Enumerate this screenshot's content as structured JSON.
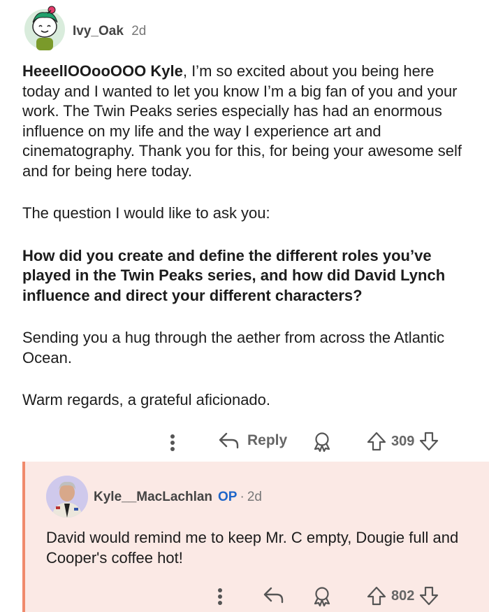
{
  "comment": {
    "username": "Ivy_Oak",
    "age": "2d",
    "body": {
      "p1_bold": "HeeellOOooOOO Kyle",
      "p1_rest": ", I’m so excited about you being here today and I wanted to let you know I’m a big fan of you and your work. The Twin Peaks series especially has had an enormous influence on my life and the way I experience art and cinematography. Thank you for this, for being your awesome self and for being here today.",
      "p2": "The question I would like to ask you:",
      "p3": "How did you create and define the different roles you’ve played in the Twin Peaks series, and how did David Lynch influence and direct your different characters?",
      "p4": "Sending you a hug through the aether from across the Atlantic Ocean.",
      "p5": "Warm regards, a grateful aficionado."
    },
    "actions": {
      "more_icon": "more-vertical-icon",
      "reply_icon": "reply-arrow-icon",
      "reply_label": "Reply",
      "award_icon": "award-icon",
      "upvote_icon": "upvote-arrow-icon",
      "score": "309",
      "downvote_icon": "downvote-arrow-icon"
    }
  },
  "reply": {
    "username": "Kyle__MacLachlan",
    "op_badge": "OP",
    "separator": "·",
    "age": "2d",
    "body": "David would remind me to keep Mr. C empty, Dougie full and Cooper's coffee hot!",
    "actions": {
      "score": "802"
    }
  },
  "colors": {
    "reply_background": "#fbe9e5",
    "reply_border": "#f08a6c",
    "op_badge": "#1f66c9",
    "action_gray": "#666666"
  }
}
